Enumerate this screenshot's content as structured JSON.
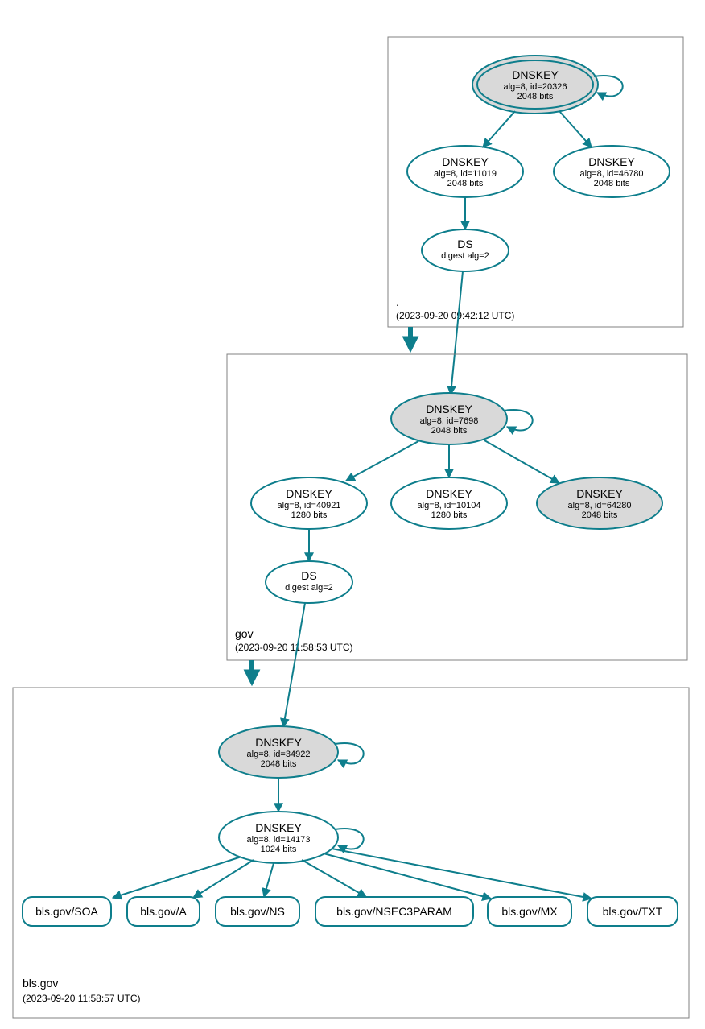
{
  "colors": {
    "stroke": "#0e7e8c",
    "gray_fill": "#d9d9d9",
    "box_stroke": "#808080"
  },
  "zones": {
    "root": {
      "label": ".",
      "timestamp": "(2023-09-20 09:42:12 UTC)"
    },
    "gov": {
      "label": "gov",
      "timestamp": "(2023-09-20 11:58:53 UTC)"
    },
    "bls": {
      "label": "bls.gov",
      "timestamp": "(2023-09-20 11:58:57 UTC)"
    }
  },
  "nodes": {
    "root_ksk": {
      "title": "DNSKEY",
      "alg": "alg=8, id=20326",
      "bits": "2048 bits"
    },
    "root_zsk1": {
      "title": "DNSKEY",
      "alg": "alg=8, id=11019",
      "bits": "2048 bits"
    },
    "root_zsk2": {
      "title": "DNSKEY",
      "alg": "alg=8, id=46780",
      "bits": "2048 bits"
    },
    "root_ds": {
      "title": "DS",
      "alg": "digest alg=2"
    },
    "gov_ksk": {
      "title": "DNSKEY",
      "alg": "alg=8, id=7698",
      "bits": "2048 bits"
    },
    "gov_zsk1": {
      "title": "DNSKEY",
      "alg": "alg=8, id=40921",
      "bits": "1280 bits"
    },
    "gov_zsk2": {
      "title": "DNSKEY",
      "alg": "alg=8, id=10104",
      "bits": "1280 bits"
    },
    "gov_ksk2": {
      "title": "DNSKEY",
      "alg": "alg=8, id=64280",
      "bits": "2048 bits"
    },
    "gov_ds": {
      "title": "DS",
      "alg": "digest alg=2"
    },
    "bls_ksk": {
      "title": "DNSKEY",
      "alg": "alg=8, id=34922",
      "bits": "2048 bits"
    },
    "bls_zsk": {
      "title": "DNSKEY",
      "alg": "alg=8, id=14173",
      "bits": "1024 bits"
    }
  },
  "rrsets": {
    "soa": "bls.gov/SOA",
    "a": "bls.gov/A",
    "ns": "bls.gov/NS",
    "nsec3": "bls.gov/NSEC3PARAM",
    "mx": "bls.gov/MX",
    "txt": "bls.gov/TXT"
  }
}
